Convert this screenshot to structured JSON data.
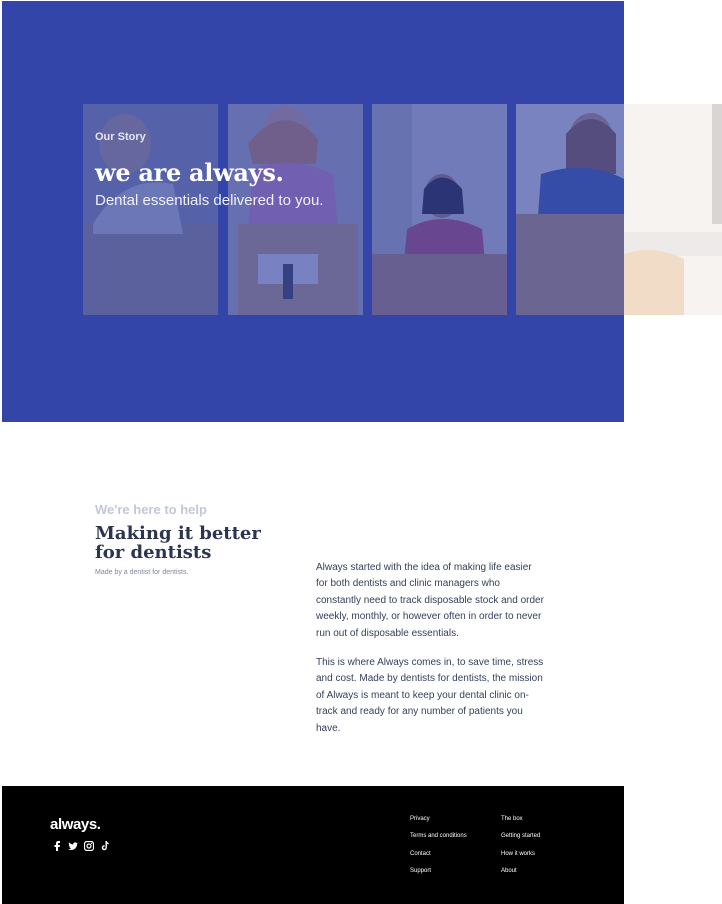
{
  "hero": {
    "eyebrow": "Our Story",
    "title": "we are always.",
    "subtitle": "Dental essentials delivered to you.",
    "bg_color": "#3346a8"
  },
  "about": {
    "eyebrow": "We're here to help",
    "title": "Making it better for dentists",
    "tagline": "Made by a dentist for dentists.",
    "paragraph_1": "Always started with the idea of making life easier for both dentists and clinic managers who constantly need to track disposable stock and order weekly, monthly, or however often in order to never run out of disposable essentials.",
    "paragraph_2": "This is where Always comes in, to save time, stress and cost. Made by dentists for dentists, the mission of Always is meant to keep your dental clinic on-track and ready for any number of patients you have."
  },
  "footer": {
    "logo": "always.",
    "social_icons": [
      "facebook-icon",
      "twitter-icon",
      "instagram-icon",
      "tiktok-icon"
    ],
    "links_col1": [
      "Privacy",
      "Terms and conditions",
      "Contact",
      "Support"
    ],
    "links_col2": [
      "The box",
      "Getting started",
      "How it works",
      "About"
    ]
  }
}
